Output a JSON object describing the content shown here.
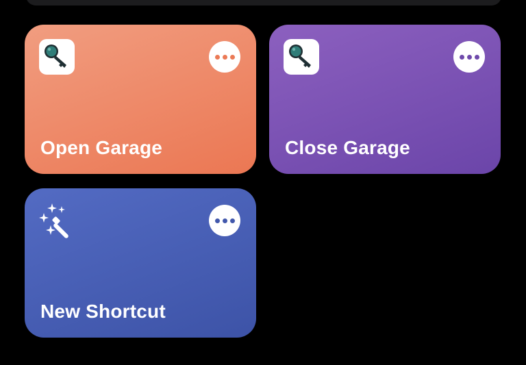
{
  "colors": {
    "open_garage_start": "#f09a7c",
    "open_garage_end": "#eb7852",
    "close_garage_start": "#8a5cbd",
    "close_garage_end": "#6a44a8",
    "new_shortcut_start": "#5169c1",
    "new_shortcut_end": "#3e54a8"
  },
  "shortcuts": [
    {
      "title": "Open Garage",
      "icon": "key-icon",
      "action": "more-options"
    },
    {
      "title": "Close Garage",
      "icon": "key-icon",
      "action": "more-options"
    },
    {
      "title": "New Shortcut",
      "icon": "magic-wand-icon",
      "action": "more-options"
    }
  ]
}
